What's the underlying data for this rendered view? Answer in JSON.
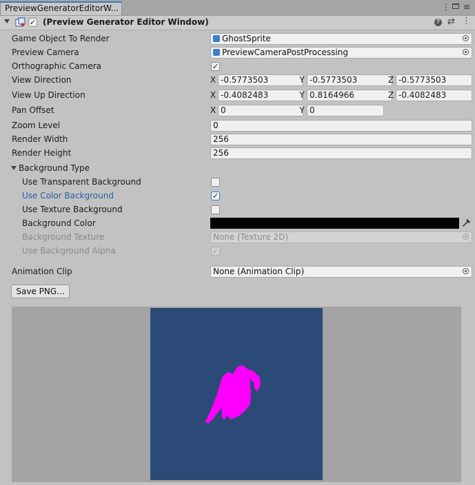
{
  "window": {
    "tab_title": "PreviewGeneratorEditorW...",
    "menu_icon": "more-vertical-icon",
    "maximize_icon": "maximize-icon"
  },
  "component": {
    "title": "(Preview Generator Editor Window)",
    "enabled": true
  },
  "fields": {
    "game_object": {
      "label": "Game Object To Render",
      "value": "GhostSprite"
    },
    "preview_camera": {
      "label": "Preview Camera",
      "value": "PreviewCameraPostProcessing"
    },
    "ortho": {
      "label": "Orthographic Camera",
      "checked": "✓"
    },
    "view_dir": {
      "label": "View Direction",
      "x": "-0.5773503",
      "y": "-0.5773503",
      "z": "-0.5773503"
    },
    "view_up": {
      "label": "View Up Direction",
      "x": "-0.4082483",
      "y": "0.8164966",
      "z": "-0.4082483"
    },
    "pan": {
      "label": "Pan Offset",
      "x": "0",
      "y": "0"
    },
    "zoom": {
      "label": "Zoom Level",
      "value": "0"
    },
    "width": {
      "label": "Render Width",
      "value": "256"
    },
    "height": {
      "label": "Render Height",
      "value": "256"
    }
  },
  "background": {
    "foldout_label": "Background Type",
    "transparent": {
      "label": "Use Transparent Background",
      "checked": ""
    },
    "color": {
      "label": "Use Color Background",
      "checked": "✓"
    },
    "texture": {
      "label": "Use Texture Background",
      "checked": ""
    },
    "bg_color": {
      "label": "Background Color",
      "value_hex": "#000000"
    },
    "bg_texture": {
      "label": "Background Texture",
      "value": "None (Texture 2D)"
    },
    "bg_alpha": {
      "label": "Use Background Alpha",
      "checked": "✓"
    }
  },
  "animation": {
    "label": "Animation Clip",
    "value": "None (Animation Clip)"
  },
  "save_button": "Save PNG...",
  "axis": {
    "x": "X",
    "y": "Y",
    "z": "Z"
  },
  "colors": {
    "preview_bg": "#2c4a77",
    "sprite": "#ff00ff"
  }
}
